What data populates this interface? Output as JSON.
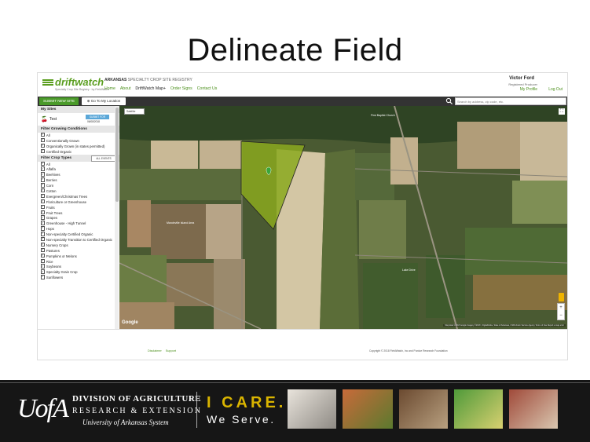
{
  "slide": {
    "title": "Delineate Field"
  },
  "app": {
    "logo": "driftwatch",
    "logo_subtitle": "Specialty Crop Site Registry · by FieldWatch",
    "state": "ARKANSAS",
    "registry": "SPECIALTY CROP SITE REGISTRY",
    "nav": [
      "Home",
      "About",
      "DriftWatch Map+",
      "Order Signs",
      "Contact Us"
    ],
    "user": {
      "name": "Victor Ford",
      "role": "Registered Producer",
      "profile": "My Profile",
      "logout": "Log Out"
    }
  },
  "toolbar": {
    "submit": "SUBMIT NEW SITE",
    "locate": "Go To My Location",
    "search_placeholder": "Search by address, zip code, etc."
  },
  "sidebar": {
    "my_sites_header": "My Sites",
    "site": {
      "name": "Test",
      "button": "SUBMIT FOR",
      "date": "06/08/2018"
    },
    "growing_header": "Filter Growing Conditions",
    "growing": [
      "All",
      "Conventionally Grown",
      "Organically Grown (in states permitted)",
      "Certified Organic"
    ],
    "crop_header": "Filter Crop Types",
    "crop_select": "ALL EVENTS",
    "crops": [
      "All",
      "Alfalfa",
      "Beehives",
      "Berries",
      "Corn",
      "Cotton",
      "Evergreen/Christmas Trees",
      "Floriculture or Greenhouse",
      "Fruits",
      "Fruit Trees",
      "Grapes",
      "Greenhouse - High Tunnel",
      "Hops",
      "Non-specialty Certified Organic",
      "Non-specialty Transition to Certified Organic",
      "Nursery Crops",
      "Pastures",
      "Pumpkins or Melons",
      "Rice",
      "Soybeans",
      "Specialty Grain Crop",
      "Sunflowers"
    ]
  },
  "map": {
    "type": "Satellite",
    "labels": {
      "church": "First Baptist Church",
      "tract": "Mandeville Island Area",
      "road": "Lake Drive"
    },
    "google": "Google",
    "attribution": "Map data ©2018 Google Imagery ©2018 , DigitalGlobe, State of Arkansas, USDA Farm Service Agency   Terms of Use   Report a map error",
    "polygon_color": "#8aa81e"
  },
  "footer": {
    "links": [
      "Disclaimer",
      "Support"
    ],
    "copyright": "Copyright © 2018 FieldWatch, Inc and Purdue Research Foundation"
  },
  "banner": {
    "logo": "UofA",
    "division": "DIVISION OF AGRICULTURE",
    "research": "RESEARCH & EXTENSION",
    "system": "University of Arkansas System",
    "icare": "I CARE.",
    "weserve": "We Serve."
  },
  "colors": {
    "accent_green": "#4a9a2a",
    "icare_gold": "#d9b400",
    "banner_bg": "#161616"
  }
}
